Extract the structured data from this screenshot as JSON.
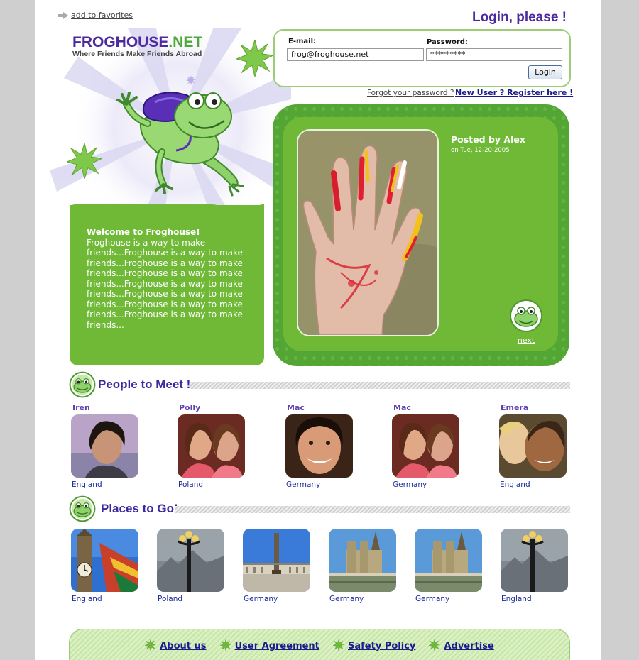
{
  "header": {
    "favorites_label": "add to favorites",
    "logo_name": "FROGHOUSE",
    "logo_tld": ".NET",
    "tagline": "Where Friends Make Friends Abroad",
    "login_title": "Login, please !"
  },
  "login": {
    "email_label": "E-mail:",
    "email_value": "frog@froghouse.net",
    "password_label": "Password:",
    "password_value": "*********",
    "button_label": "Login",
    "forgot_label": "Forgot your password ?",
    "register_label": "New User ? Register here !"
  },
  "welcome": {
    "title": "Welcome to Froghouse!",
    "text": "Froghouse is a way to make friends...Froghouse is a way to make friends...Froghouse is a way to make friends...Froghouse is a way to make friends...Froghouse is a way to make friends...Froghouse is a way to make friends...Froghouse is a way to make friends...Froghouse is a way to make friends..."
  },
  "featured": {
    "posted_by": "Posted by Alex",
    "posted_on": "on Tue, 12-20-2005",
    "next_label": "next"
  },
  "people": {
    "title": "People to Meet !",
    "items": [
      {
        "name": "Iren",
        "country": "England"
      },
      {
        "name": "Polly",
        "country": "Poland"
      },
      {
        "name": "Mac",
        "country": "Germany"
      },
      {
        "name": "Mac",
        "country": "Germany"
      },
      {
        "name": "Emera",
        "country": "England"
      }
    ]
  },
  "places": {
    "title": "Places to Go!",
    "items": [
      {
        "country": "England",
        "scene": "big-ben"
      },
      {
        "country": "Poland",
        "scene": "lamp-post"
      },
      {
        "country": "Germany",
        "scene": "column-square"
      },
      {
        "country": "Germany",
        "scene": "cathedral"
      },
      {
        "country": "Germany",
        "scene": "cathedral"
      },
      {
        "country": "England",
        "scene": "lamp-post"
      }
    ]
  },
  "footer": {
    "links": [
      "About us",
      "User Agreement",
      "Safety Policy",
      "Advertise"
    ]
  },
  "colors": {
    "brand_purple": "#4b2a9f",
    "brand_green": "#6fb936",
    "link_blue": "#1c1a8c"
  }
}
